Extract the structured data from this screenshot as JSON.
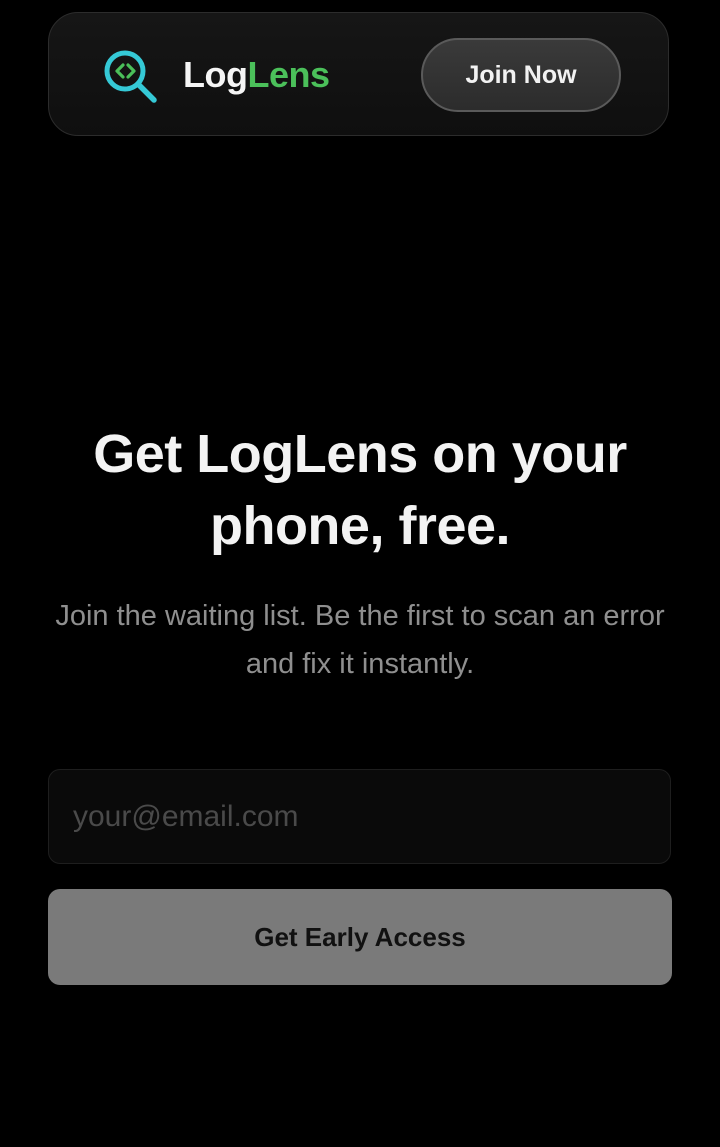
{
  "header": {
    "brand_part1": "Log",
    "brand_part2": "Lens",
    "join_label": "Join Now",
    "logo_icon": "magnifier-code-icon"
  },
  "hero": {
    "headline": "Get LogLens on your phone, free.",
    "subtitle": "Join the waiting list. Be the first to scan an error and fix it instantly."
  },
  "signup": {
    "email_placeholder": "your@email.com",
    "email_value": "",
    "submit_label": "Get Early Access"
  },
  "colors": {
    "background": "#000000",
    "brand_accent": "#4bc05a",
    "logo_accent": "#35c9d6",
    "subtitle_text": "#8f8f8f",
    "cta_background": "#7a7a7a"
  }
}
